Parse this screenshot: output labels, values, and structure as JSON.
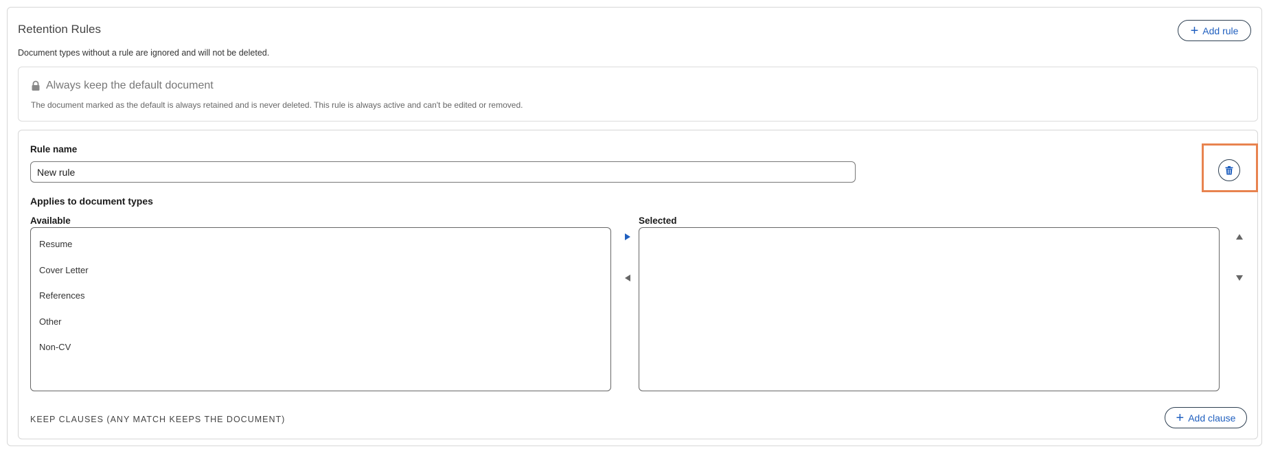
{
  "section": {
    "title": "Retention Rules",
    "subtitle": "Document types without a rule are ignored and will not be deleted.",
    "add_rule_label": "Add rule"
  },
  "default_rule": {
    "title": "Always keep the default document",
    "description": "The document marked as the default is always retained and is never deleted. This rule is always active and can't be edited or removed."
  },
  "rule": {
    "name_label": "Rule name",
    "name_value": "New rule",
    "applies_label": "Applies to document types",
    "available_label": "Available",
    "selected_label": "Selected",
    "available_items": [
      "Resume",
      "Cover Letter",
      "References",
      "Other",
      "Non-CV"
    ],
    "selected_items": [],
    "keep_clauses_label": "KEEP CLAUSES (ANY MATCH KEEPS THE DOCUMENT)",
    "add_clause_label": "Add clause"
  },
  "colors": {
    "accent": "#1f5fbf",
    "highlight": "#e8834f"
  },
  "icons": {
    "add_rule": "plus-icon",
    "lock": "lock-icon",
    "delete": "trash-icon",
    "move_right": "caret-right-icon",
    "move_left": "caret-left-icon",
    "move_up": "caret-up-icon",
    "move_down": "caret-down-icon",
    "add_clause": "plus-icon"
  }
}
